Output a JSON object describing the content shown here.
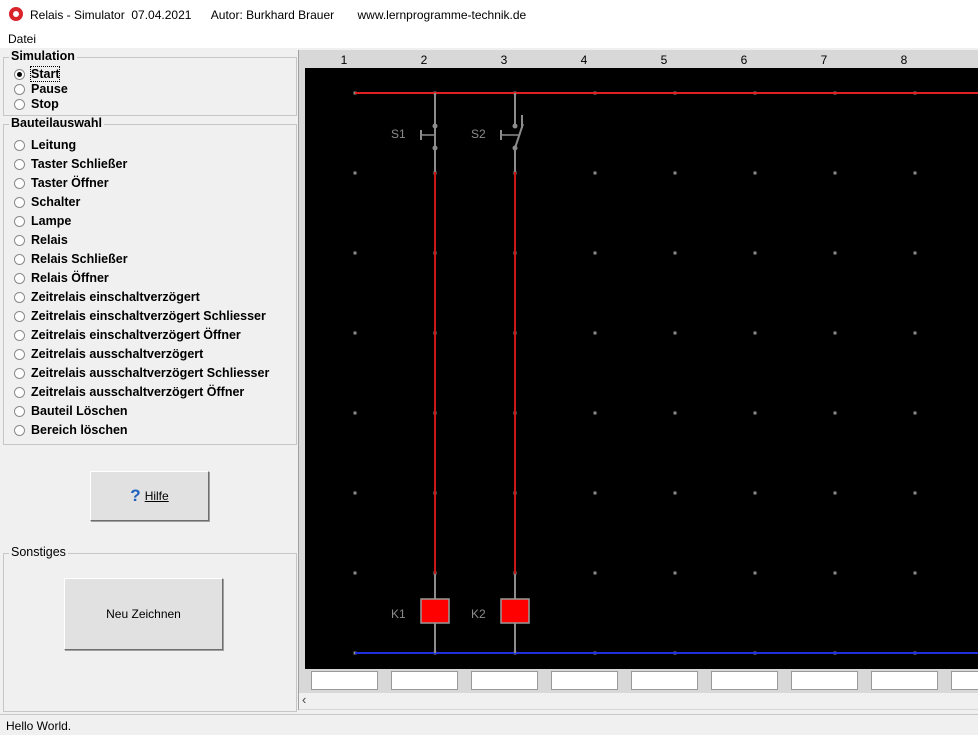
{
  "window": {
    "title": "Relais - Simulator  07.04.2021      Autor: Burkhard Brauer       www.lernprogramme-technik.de"
  },
  "menu": {
    "items": [
      "Datei"
    ]
  },
  "simulation": {
    "label": "Simulation",
    "options": [
      {
        "label": "Start",
        "checked": true
      },
      {
        "label": "Pause",
        "checked": false
      },
      {
        "label": "Stop",
        "checked": false
      }
    ]
  },
  "bauteilauswahl": {
    "label": "Bauteilauswahl",
    "options": [
      "Leitung",
      "Taster Schließer",
      "Taster Öffner",
      "Schalter",
      "Lampe",
      "Relais",
      "Relais Schließer",
      "Relais Öffner",
      "Zeitrelais einschaltverzögert",
      "Zeitrelais einschaltverzögert Schliesser",
      "Zeitrelais einschaltverzögert Öffner",
      "Zeitrelais ausschaltverzögert",
      "Zeitrelais ausschaltverzögert Schliesser",
      "Zeitrelais ausschaltverzögert Öffner",
      "Bauteil Löschen",
      "Bereich löschen"
    ]
  },
  "help_button": {
    "label": "Hilfe",
    "icon": "question-icon"
  },
  "sonstiges": {
    "label": "Sonstiges",
    "button": "Neu Zeichnen"
  },
  "canvas": {
    "columns": [
      "1",
      "2",
      "3",
      "4",
      "5",
      "6",
      "7",
      "8"
    ],
    "components": [
      {
        "label": "S1",
        "type": "pushbutton-normally-open"
      },
      {
        "label": "S2",
        "type": "pushbutton-normally-closed"
      },
      {
        "label": "K1",
        "type": "relay-coil"
      },
      {
        "label": "K2",
        "type": "relay-coil"
      }
    ],
    "colors": {
      "background": "#000000",
      "top_rail": "#e02020",
      "bottom_rail": "#2030e0",
      "wire_active": "#c81818",
      "wire_inactive": "#8c8c8c",
      "coil": "#ff0000"
    }
  },
  "status": {
    "text": "Hello World."
  }
}
